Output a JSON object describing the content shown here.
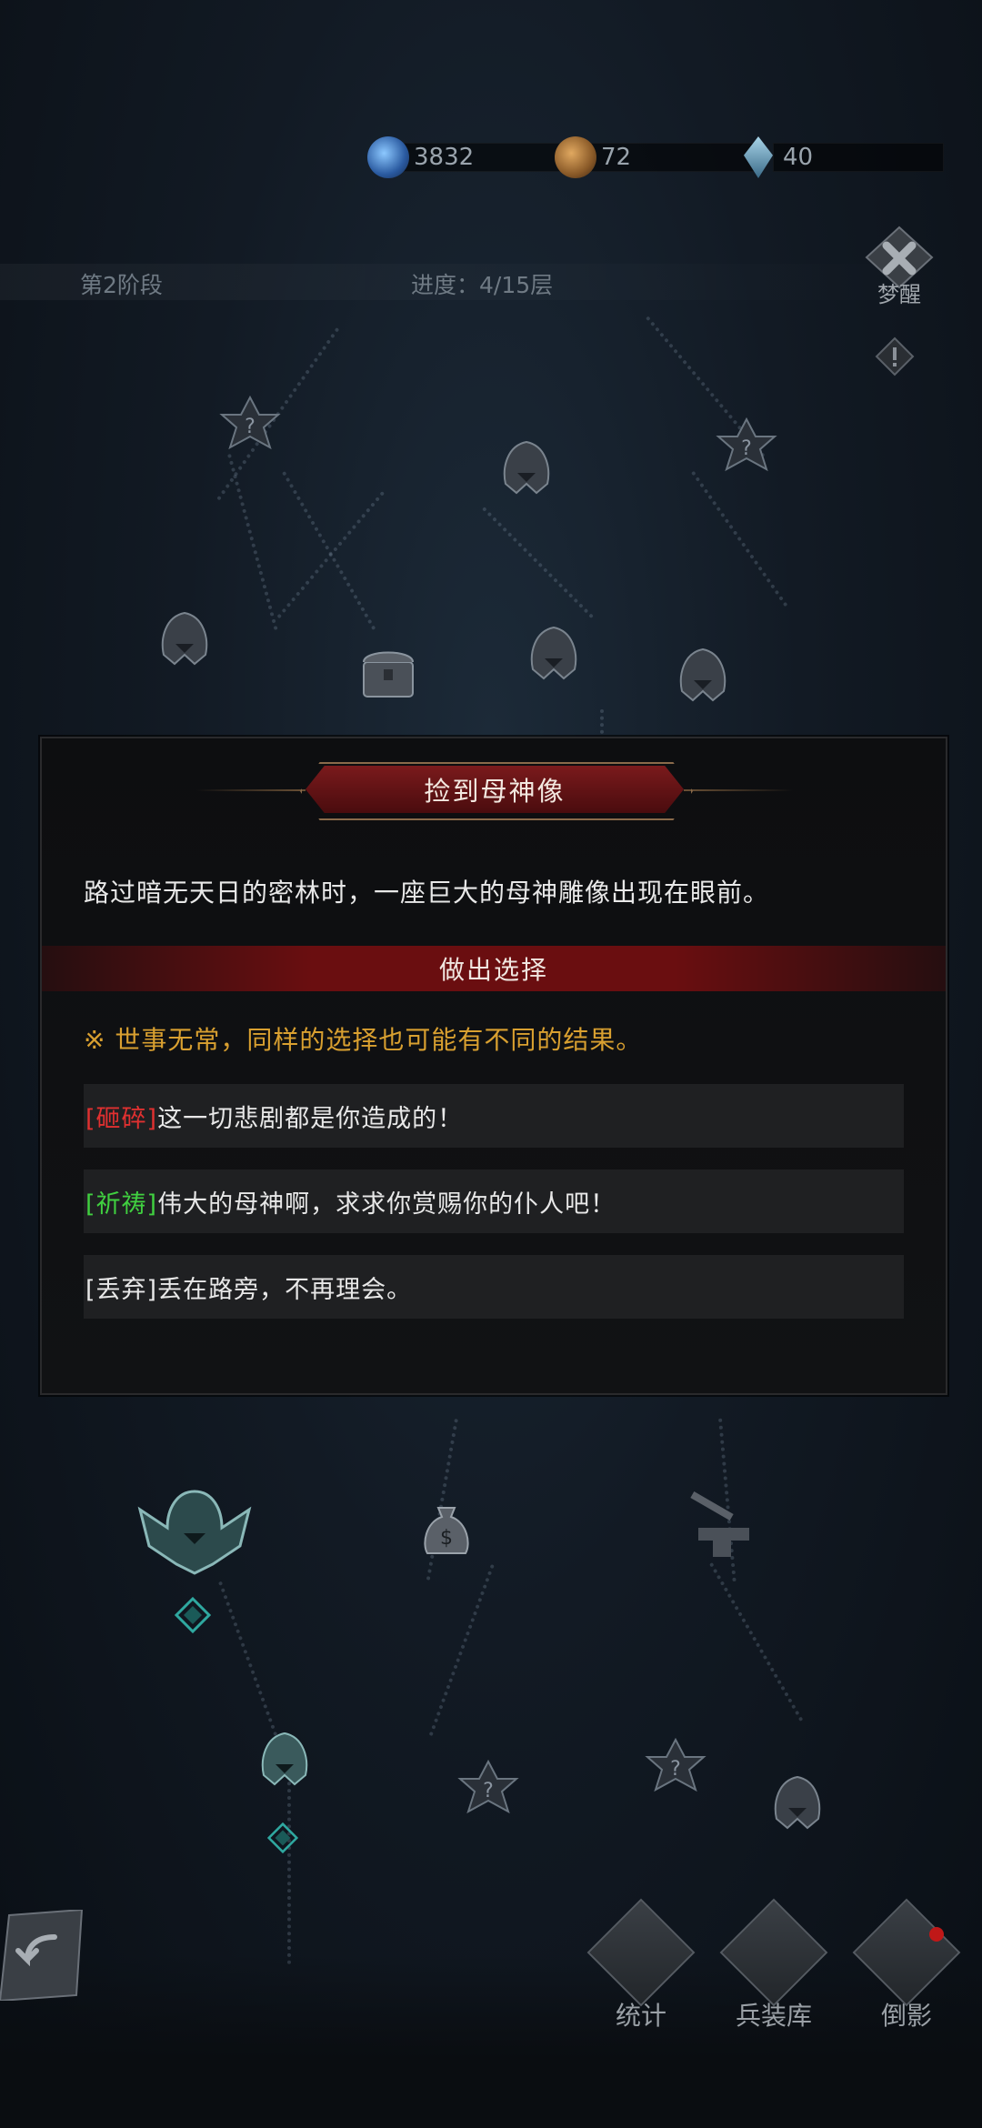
{
  "resources": [
    {
      "icon": "soul-orb-icon",
      "value": "3832",
      "color": "#3a7fd0"
    },
    {
      "icon": "coin-icon",
      "value": "72",
      "color": "#9a6a30"
    },
    {
      "icon": "crystal-icon",
      "value": "40",
      "color": "#6a9ab0"
    }
  ],
  "header": {
    "stage": "第2阶段",
    "progress": "进度：4/15层",
    "wake_label": "梦醒"
  },
  "dialog": {
    "title": "捡到母神像",
    "description": "路过暗无天日的密林时，一座巨大的母神雕像出现在眼前。",
    "choose_label": "做出选择",
    "warning": "※ 世事无常，同样的选择也可能有不同的结果。",
    "options": [
      {
        "tag": "[砸碎]",
        "text": "这一切悲剧都是你造成的！",
        "tag_color": "#e03030"
      },
      {
        "tag": "[祈祷]",
        "text": "伟大的母神啊，求求你赏赐你的仆人吧！",
        "tag_color": "#40d040"
      },
      {
        "tag": "[丢弃]",
        "text": "丢在路旁，不再理会。",
        "tag_color": "#e8e8e8"
      }
    ]
  },
  "bottom_nav": {
    "stats": "统计",
    "armory": "兵装库",
    "reflection": "倒影"
  }
}
